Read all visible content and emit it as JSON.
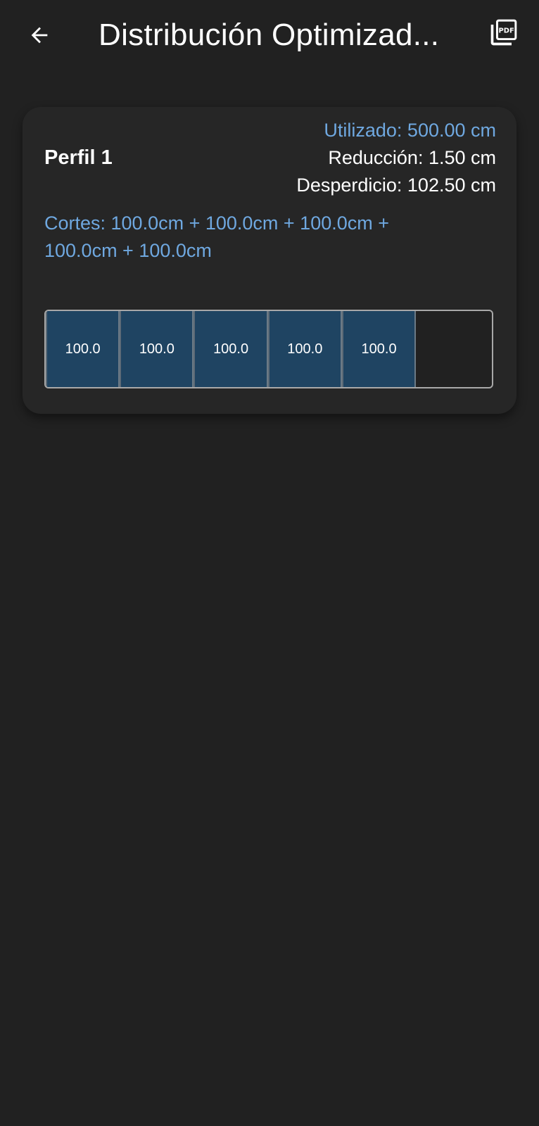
{
  "appbar": {
    "title": "Distribución Optimizad...",
    "back_icon": "arrow-left-icon",
    "pdf_icon": "pdf-icon"
  },
  "card": {
    "profile_name": "Perfil 1",
    "stats": {
      "used": "Utilizado: 500.00 cm",
      "reduction": "Reducción: 1.50 cm",
      "waste": "Desperdicio: 102.50 cm"
    },
    "cuts_text": "Cortes: 100.0cm + 100.0cm + 100.0cm + 100.0cm + 100.0cm",
    "bar": {
      "segments": [
        {
          "label": "100.0",
          "value": 100.0
        },
        {
          "label": "100.0",
          "value": 100.0
        },
        {
          "label": "100.0",
          "value": 100.0
        },
        {
          "label": "100.0",
          "value": 100.0
        },
        {
          "label": "100.0",
          "value": 100.0
        }
      ],
      "used_fraction": 0.83
    }
  },
  "colors": {
    "background": "#212121",
    "card": "#262626",
    "accent": "#6fa8e0",
    "segment": "#1f4462"
  }
}
